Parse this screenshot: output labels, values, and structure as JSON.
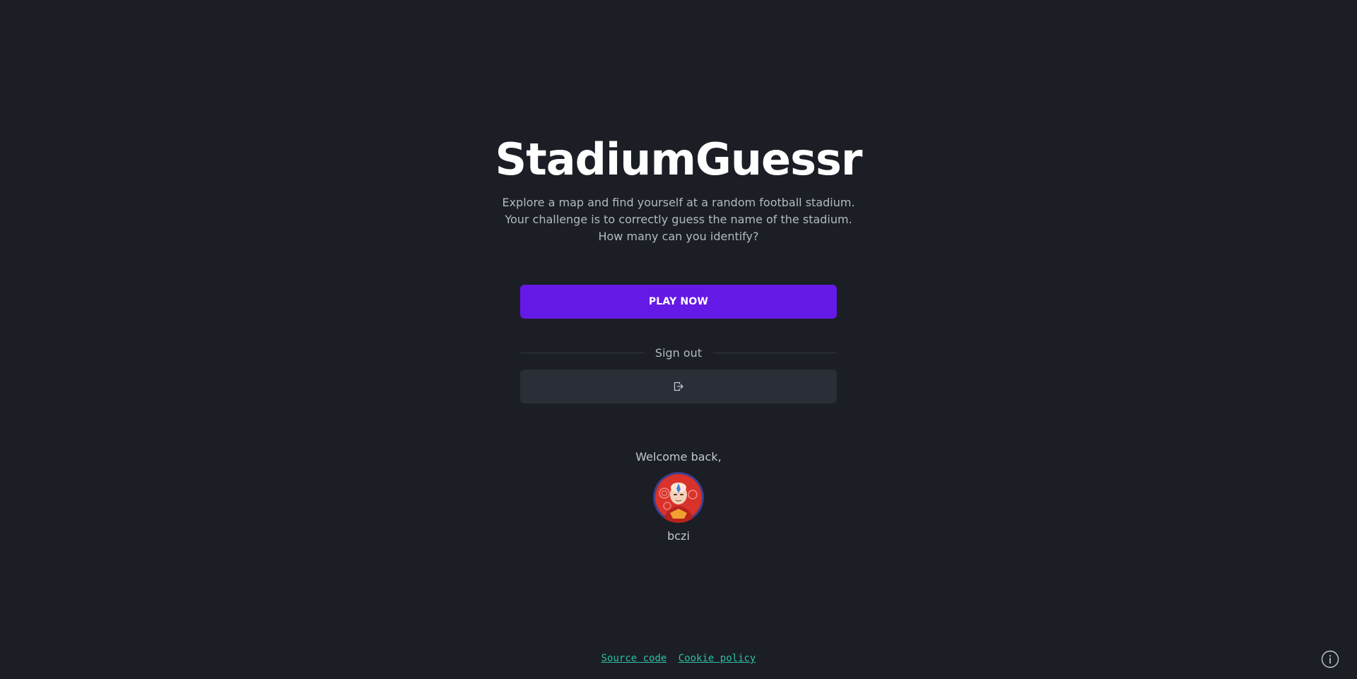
{
  "app": {
    "title": "StadiumGuessr",
    "description_lines": [
      "Explore a map and find yourself at a random football stadium.",
      "Your challenge is to correctly guess the name of the stadium.",
      "How many can you identify?"
    ]
  },
  "actions": {
    "play_label": "PLAY NOW",
    "divider_label": "Sign out",
    "signout_icon": "logout-icon"
  },
  "user": {
    "welcome_text": "Welcome back,",
    "avatar_icon": "user-avatar",
    "username": "bczi"
  },
  "footer": {
    "links": [
      "Source code",
      "Cookie policy"
    ],
    "info_icon": "info-icon"
  },
  "colors": {
    "background": "#1b1e25",
    "primary": "#6419e6",
    "secondary_button": "#2a2e37",
    "link": "#2fbfa0"
  }
}
